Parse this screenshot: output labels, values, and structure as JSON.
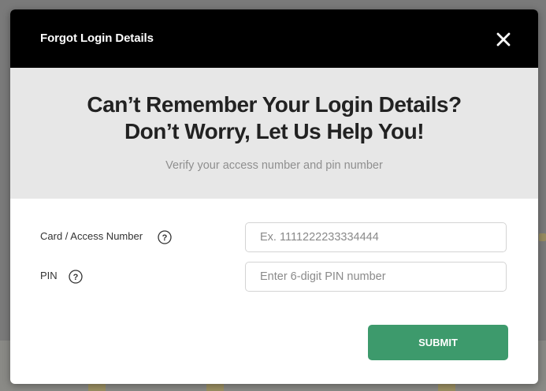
{
  "modal": {
    "title": "Forgot Login Details",
    "close_icon": "close-icon"
  },
  "hero": {
    "title_line1": "Can’t Remember Your Login Details?",
    "title_line2": "Don’t Worry, Let Us Help You!",
    "subtitle": "Verify your access number and pin number"
  },
  "form": {
    "card_label": "Card / Access Number",
    "card_placeholder": "Ex. 1111222233334444",
    "card_value": "",
    "pin_label": "PIN",
    "pin_placeholder": "Enter 6-digit PIN number",
    "pin_value": "",
    "help_icon": "question-circle-icon",
    "submit_label": "SUBMIT"
  },
  "colors": {
    "header_bg": "#000000",
    "hero_bg": "#e7e7e7",
    "submit_bg": "#3d9a6c"
  }
}
